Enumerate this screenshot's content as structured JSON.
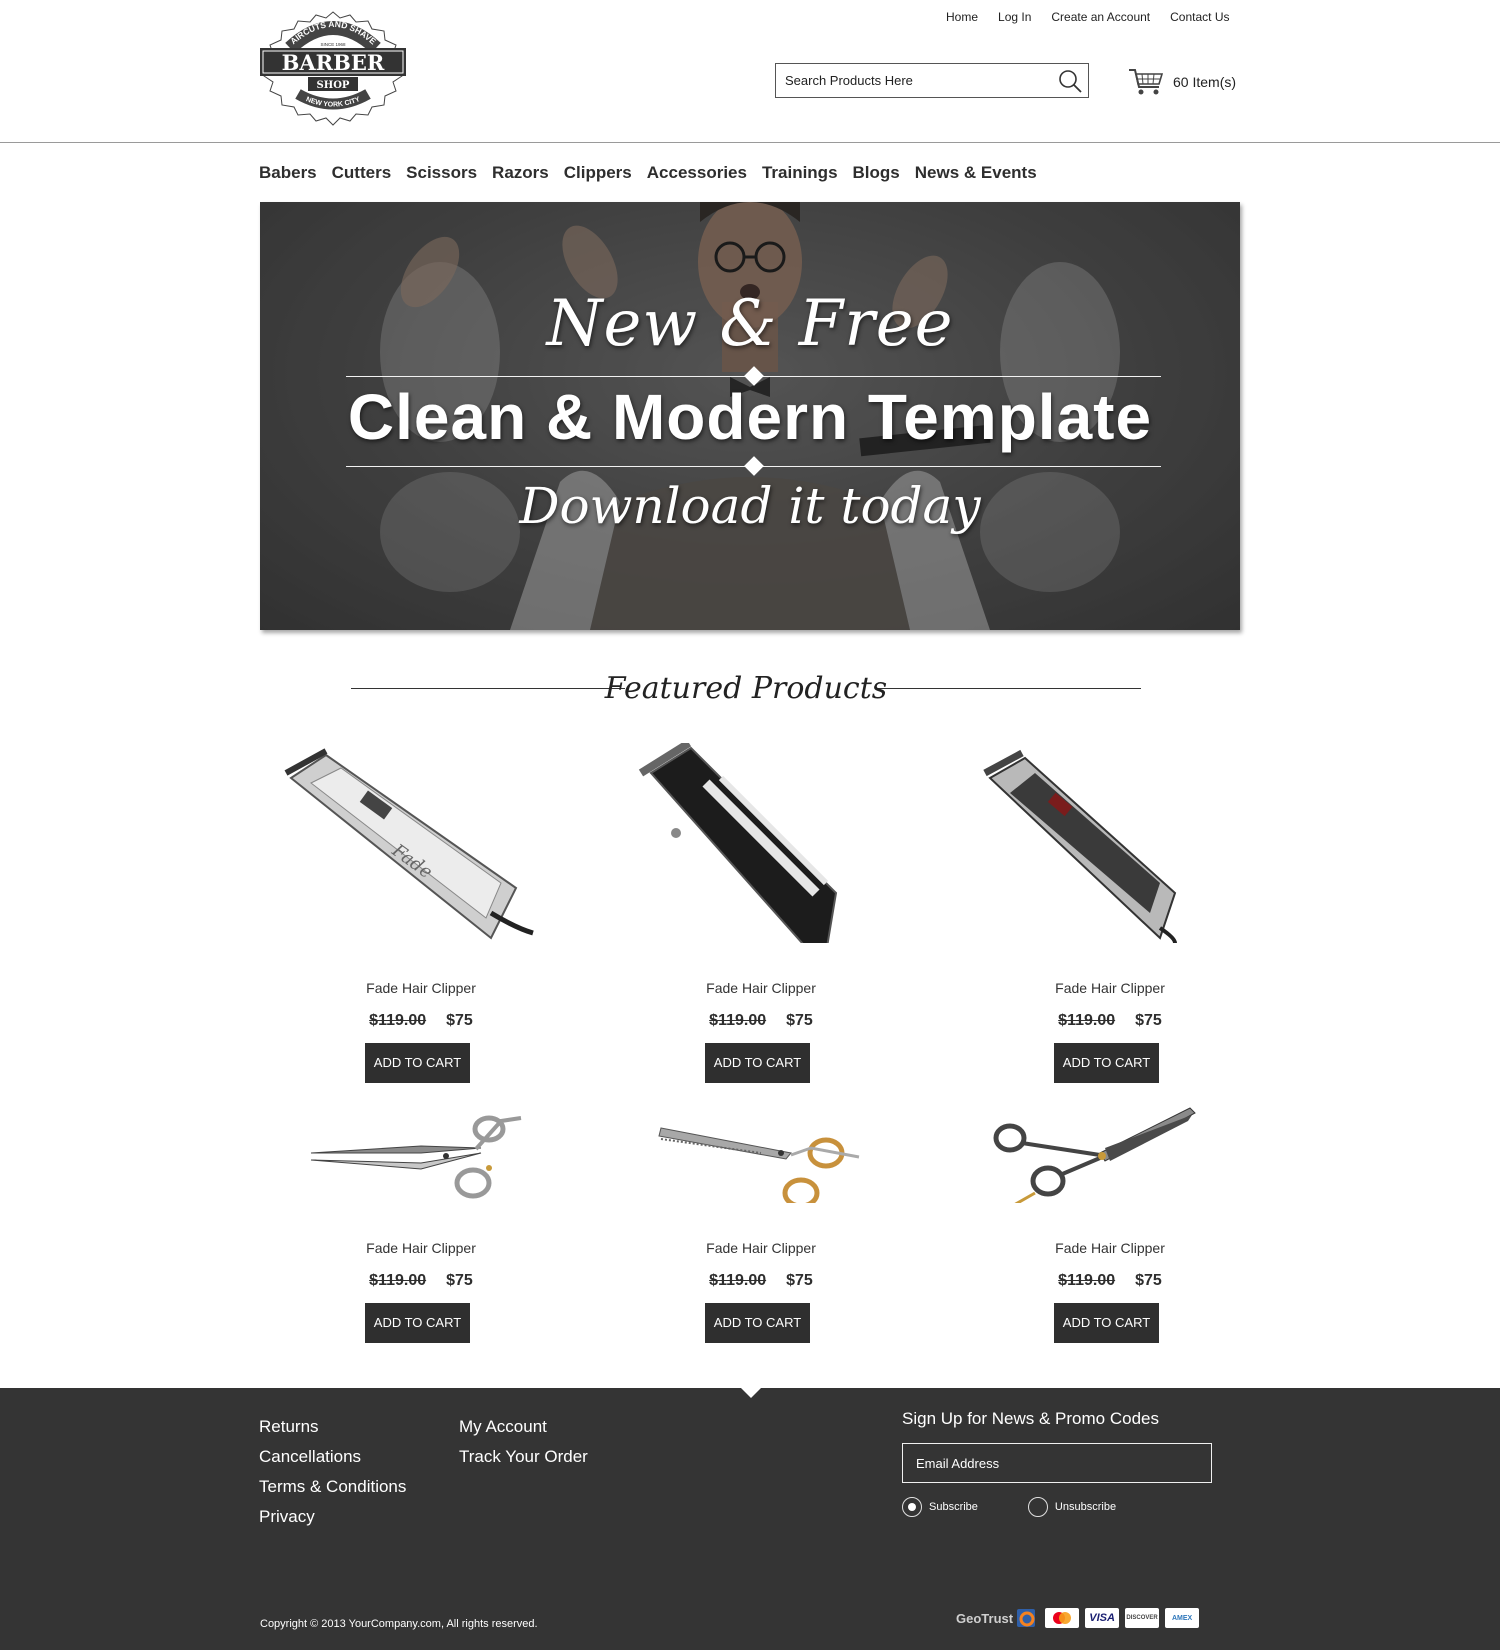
{
  "header": {
    "logo": {
      "top_arc": "HAIRCUTS AND SHAVES",
      "since": "SINCE 1968",
      "main": "BARBER",
      "sub": "SHOP",
      "city": "NEW YORK CITY"
    },
    "top_links": [
      "Home",
      "Log In",
      "Create an Account",
      "Contact Us"
    ],
    "search": {
      "placeholder": "Search Products Here",
      "value": ""
    },
    "cart": {
      "label": "60 Item(s)"
    }
  },
  "nav": {
    "items": [
      "Babers",
      "Cutters",
      "Scissors",
      "Razors",
      "Clippers",
      "Accessories",
      "Trainings",
      "Blogs",
      "News & Events"
    ]
  },
  "hero": {
    "line1": "New & Free",
    "line2": "Clean & Modern Template",
    "line3": "Download it today"
  },
  "featured": {
    "title": "Featured Products",
    "products": [
      {
        "name": "Fade Hair Clipper",
        "old_price": "$119.00",
        "price": "$75",
        "button": "ADD TO CART",
        "image": "silver-clipper"
      },
      {
        "name": "Fade Hair Clipper",
        "old_price": "$119.00",
        "price": "$75",
        "button": "ADD TO CART",
        "image": "black-clipper"
      },
      {
        "name": "Fade Hair Clipper",
        "old_price": "$119.00",
        "price": "$75",
        "button": "ADD TO CART",
        "image": "chrome-clipper"
      },
      {
        "name": "Fade Hair Clipper",
        "old_price": "$119.00",
        "price": "$75",
        "button": "ADD TO CART",
        "image": "straight-scissors"
      },
      {
        "name": "Fade Hair Clipper",
        "old_price": "$119.00",
        "price": "$75",
        "button": "ADD TO CART",
        "image": "thinning-scissors"
      },
      {
        "name": "Fade Hair Clipper",
        "old_price": "$119.00",
        "price": "$75",
        "button": "ADD TO CART",
        "image": "black-scissors"
      }
    ]
  },
  "footer": {
    "col1": [
      "Returns",
      "Cancellations",
      "Terms & Conditions",
      "Privacy"
    ],
    "col2": [
      "My Account",
      "Track Your Order"
    ],
    "signup": {
      "title": "Sign Up for News & Promo Codes",
      "email_placeholder": "Email Address",
      "options": [
        "Subscribe",
        "Unsubscribe"
      ],
      "selected": "Subscribe"
    },
    "copyright": "Copyright © 2013 YourCompany.com, All rights reserved.",
    "trust": "GeoTrust",
    "cards": [
      "mastercard",
      "VISA",
      "DISCOVER",
      "AMEX"
    ]
  }
}
